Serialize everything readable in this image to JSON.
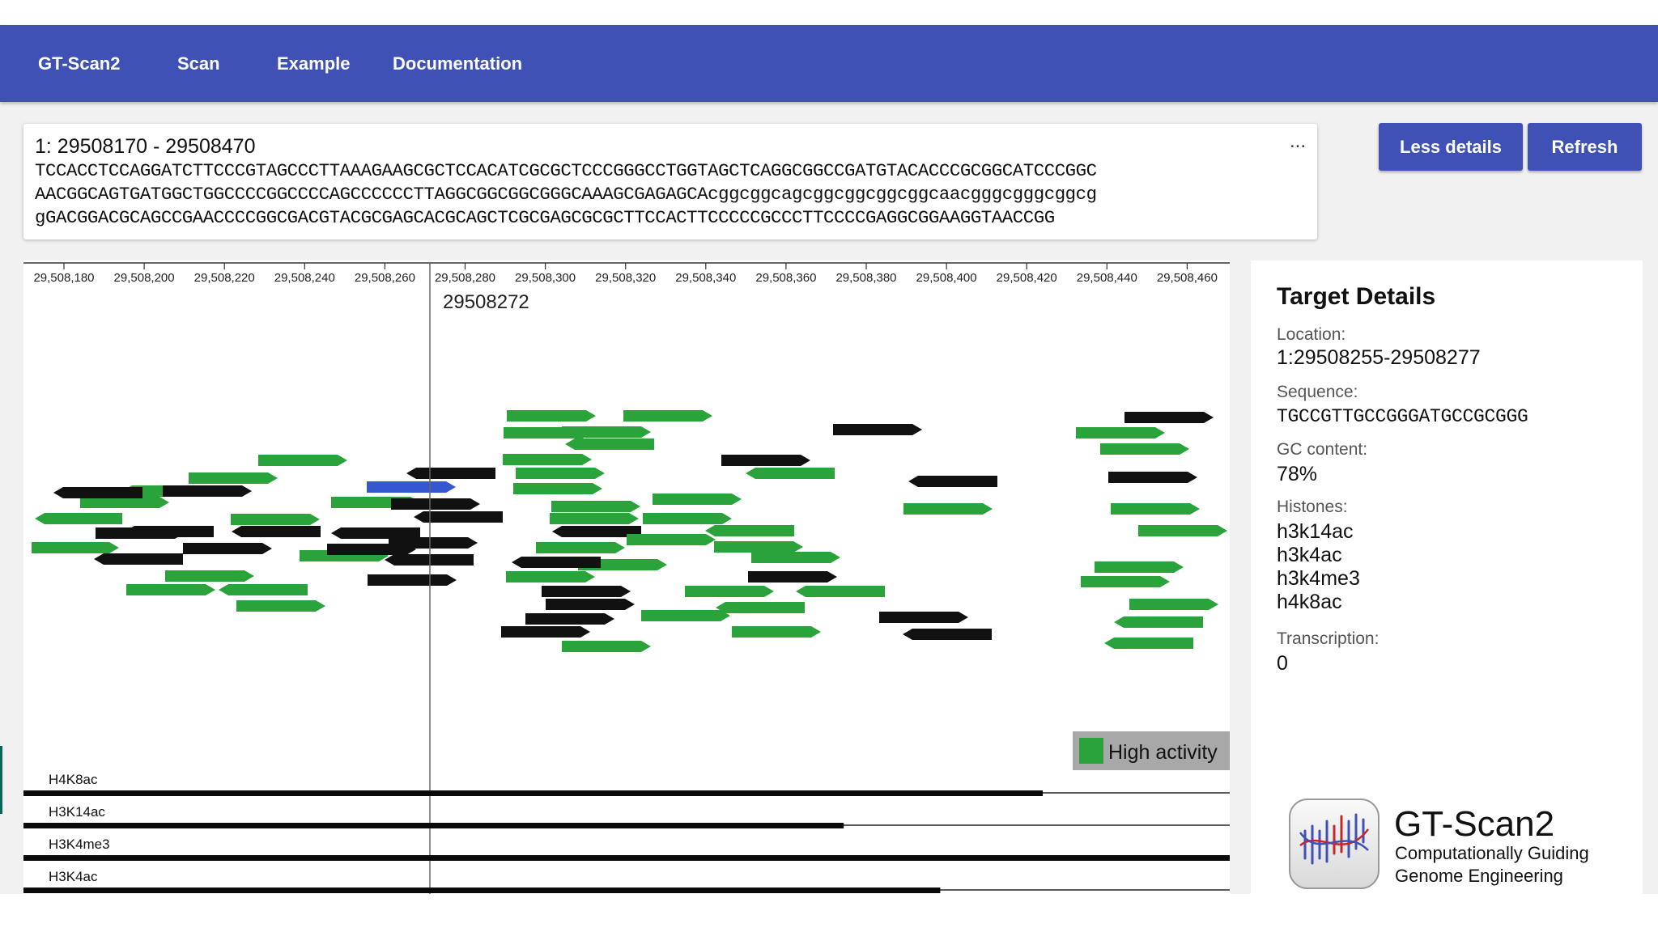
{
  "nav": {
    "brand": "GT-Scan2",
    "items": [
      "Scan",
      "Example",
      "Documentation"
    ]
  },
  "sequence": {
    "range": "1: 29508170 - 29508470",
    "more": "...",
    "lines": [
      "TCCACCTCCAGGATCTTCCCGTAGCCCTTAAAGAAGCGCTCCACATCGCGCTCCCGGGCCTGGTAGCTCAGGCGGCCGATGTACACCCGCGGCATCCCGGC",
      "AACGGCAGTGATGGCTGGCCCCGGCCCCAGCCCCCCTTAGGCGGCGGCGGGCAAAGCGAGAGCAcggcggcagcggcggcggcggcaacgggcgggcggcg",
      "gGACGGACGCAGCCGAACCCCGGCGACGTACGCGAGCACGCAGCTCGCGAGCGCGCTTCCACTTCCCCCGCCCTTCCCCGAGGCGGAAGGTAACCGG"
    ]
  },
  "buttons": {
    "less_details": "Less details",
    "refresh": "Refresh"
  },
  "viewer": {
    "ticks": [
      "29,508,180",
      "29,508,200",
      "29,508,220",
      "29,508,240",
      "29,508,260",
      "29,508,280",
      "29,508,300",
      "29,508,320",
      "29,508,340",
      "29,508,360",
      "29,508,380",
      "29,508,400",
      "29,508,420",
      "29,508,440",
      "29,508,460"
    ],
    "cursor_label": "29508272",
    "legend_label": "High activity",
    "colors": {
      "high": "#2aa33a",
      "low": "#111111",
      "selected": "#3557cf",
      "legend_bg": "#a8a8a8"
    },
    "tracks": [
      {
        "name": "H4K8ac",
        "fill": 0.845
      },
      {
        "name": "H3K14ac",
        "fill": 0.68
      },
      {
        "name": "H3K4me3",
        "fill": 1.0
      },
      {
        "name": "H3K4ac",
        "fill": 0.76
      }
    ]
  },
  "details": {
    "title": "Target Details",
    "location_label": "Location:",
    "location": "1:29508255-29508277",
    "sequence_label": "Sequence:",
    "sequence": "TGCCGTTGCCGGGATGCCGCGGG",
    "gc_label": "GC content:",
    "gc": "78%",
    "histones_label": "Histones:",
    "histones": [
      "h3k14ac",
      "h3k4ac",
      "h3k4me3",
      "h4k8ac"
    ],
    "transcription_label": "Transcription:",
    "transcription": "0"
  },
  "logo": {
    "title": "GT-Scan2",
    "subtitle_line1": "Computationally Guiding",
    "subtitle_line2": "Genome Engineering",
    "icon": "dna-icon"
  }
}
